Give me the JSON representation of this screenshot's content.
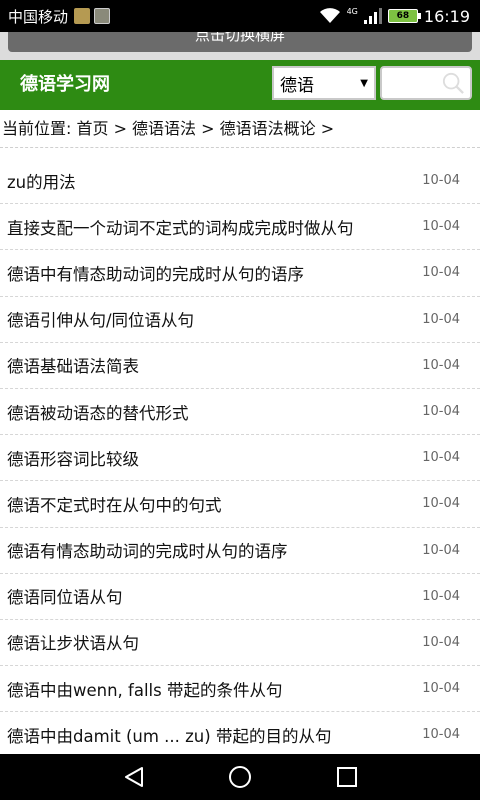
{
  "status_bar": {
    "carrier": "中国移动",
    "network": "4G",
    "battery": "68",
    "time": "16:19"
  },
  "banner": {
    "button_label": "点击切换横屏"
  },
  "header": {
    "logo": "德语学习网",
    "language_selected": "德语",
    "search_placeholder": ""
  },
  "breadcrumb": {
    "text": "当前位置: 首页 > 德语语法 > 德语语法概论 >"
  },
  "articles": [
    {
      "title": "zu的用法",
      "date": "10-04"
    },
    {
      "title": "直接支配一个动词不定式的词构成完成时做从句",
      "date": "10-04"
    },
    {
      "title": "德语中有情态助动词的完成时从句的语序",
      "date": "10-04"
    },
    {
      "title": "德语引伸从句/同位语从句",
      "date": "10-04"
    },
    {
      "title": "德语基础语法简表",
      "date": "10-04"
    },
    {
      "title": "德语被动语态的替代形式",
      "date": "10-04"
    },
    {
      "title": "德语形容词比较级",
      "date": "10-04"
    },
    {
      "title": "德语不定式时在从句中的句式",
      "date": "10-04"
    },
    {
      "title": "德语有情态助动词的完成时从句的语序",
      "date": "10-04"
    },
    {
      "title": "德语同位语从句",
      "date": "10-04"
    },
    {
      "title": "德语让步状语从句",
      "date": "10-04"
    },
    {
      "title": "德语中由wenn, falls 带起的条件从句",
      "date": "10-04"
    },
    {
      "title": "德语中由damit (um ... zu) 带起的目的从句",
      "date": "10-04"
    }
  ],
  "colors": {
    "header_green": "#2e8b13",
    "status_bar": "#000000",
    "nav_bar": "#000000"
  }
}
